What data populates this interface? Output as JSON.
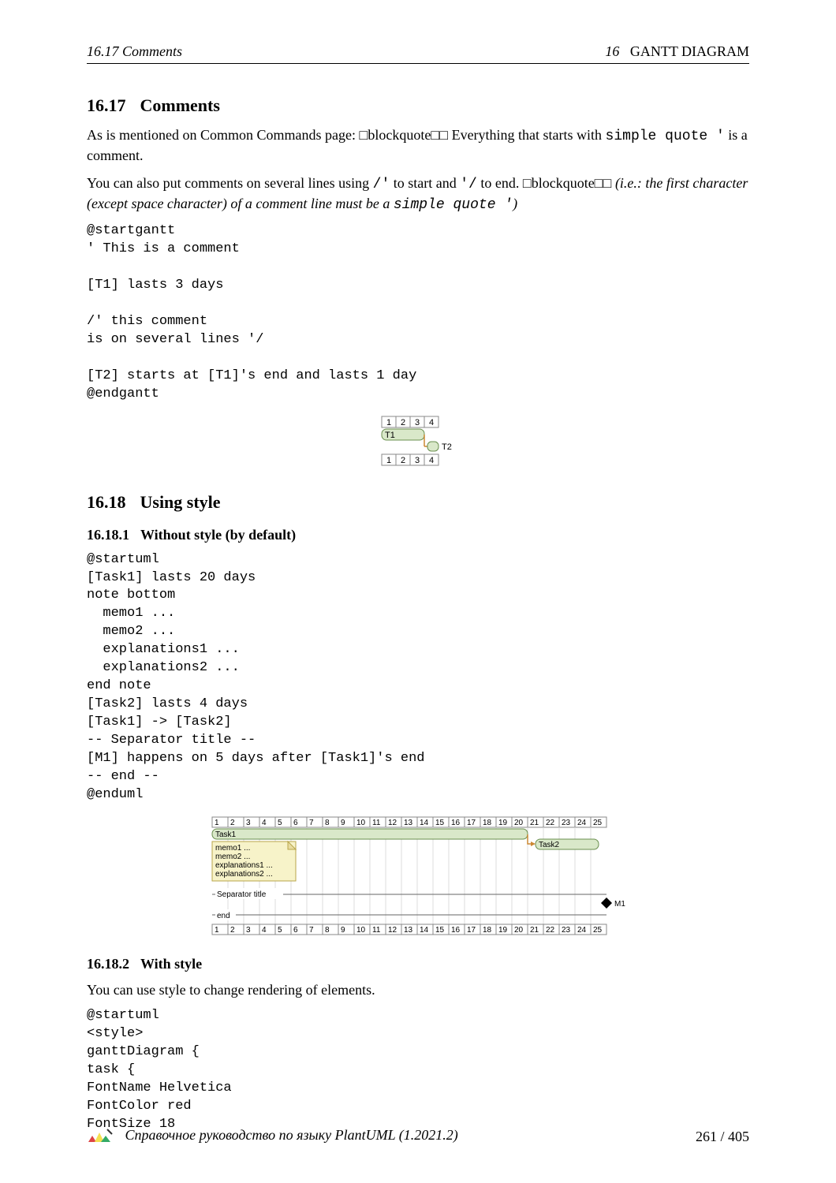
{
  "header": {
    "left": "16.17   Comments",
    "right_num": "16",
    "right_text": "GANTT DIAGRAM"
  },
  "sec1": {
    "num": "16.17",
    "title": "Comments",
    "p1a": "As is mentioned on Common Commands page:  □blockquote□□ Everything that starts with ",
    "p1b": "simple quote '",
    "p1c": " is a comment.",
    "p2a": "You can also put comments on several lines using ",
    "p2b": "/'",
    "p2c": " to start and ",
    "p2d": "'/",
    "p2e": " to end.  □blockquote□□ ",
    "p2f": "(i.e.: the first character (except space character) of a comment line must be a ",
    "p2g": "simple quote '",
    "p2h": ")",
    "code": "@startgantt\n' This is a comment\n\n[T1] lasts 3 days\n\n/' this comment\nis on several lines '/\n\n[T2] starts at [T1]'s end and lasts 1 day\n@endgantt"
  },
  "gantt1": {
    "days": [
      "1",
      "2",
      "3",
      "4"
    ],
    "t1": "T1",
    "t2": "T2"
  },
  "sec2": {
    "num": "16.18",
    "title": "Using style",
    "sub1_num": "16.18.1",
    "sub1_title": "Without style (by default)",
    "code1": "@startuml\n[Task1] lasts 20 days\nnote bottom\n  memo1 ...\n  memo2 ...\n  explanations1 ...\n  explanations2 ...\nend note\n[Task2] lasts 4 days\n[Task1] -> [Task2]\n-- Separator title --\n[M1] happens on 5 days after [Task1]'s end\n-- end --\n@enduml",
    "sub2_num": "16.18.2",
    "sub2_title": "With style",
    "p2": "You can use style to change rendering of elements.",
    "code2": "@startuml\n<style>\nganttDiagram {\ntask {\nFontName Helvetica\nFontColor red\nFontSize 18"
  },
  "gantt2": {
    "days": [
      "1",
      "2",
      "3",
      "4",
      "5",
      "6",
      "7",
      "8",
      "9",
      "10",
      "11",
      "12",
      "13",
      "14",
      "15",
      "16",
      "17",
      "18",
      "19",
      "20",
      "21",
      "22",
      "23",
      "24",
      "25"
    ],
    "task1": "Task1",
    "note": [
      "memo1 ...",
      "memo2 ...",
      "explanations1 ...",
      "explanations2 ..."
    ],
    "sep": "Separator title",
    "end": "end",
    "task2": "Task2",
    "m1": "M1"
  },
  "footer": {
    "title": "Справочное руководство по языку PlantUML (1.2021.2)",
    "page": "261 / 405"
  }
}
